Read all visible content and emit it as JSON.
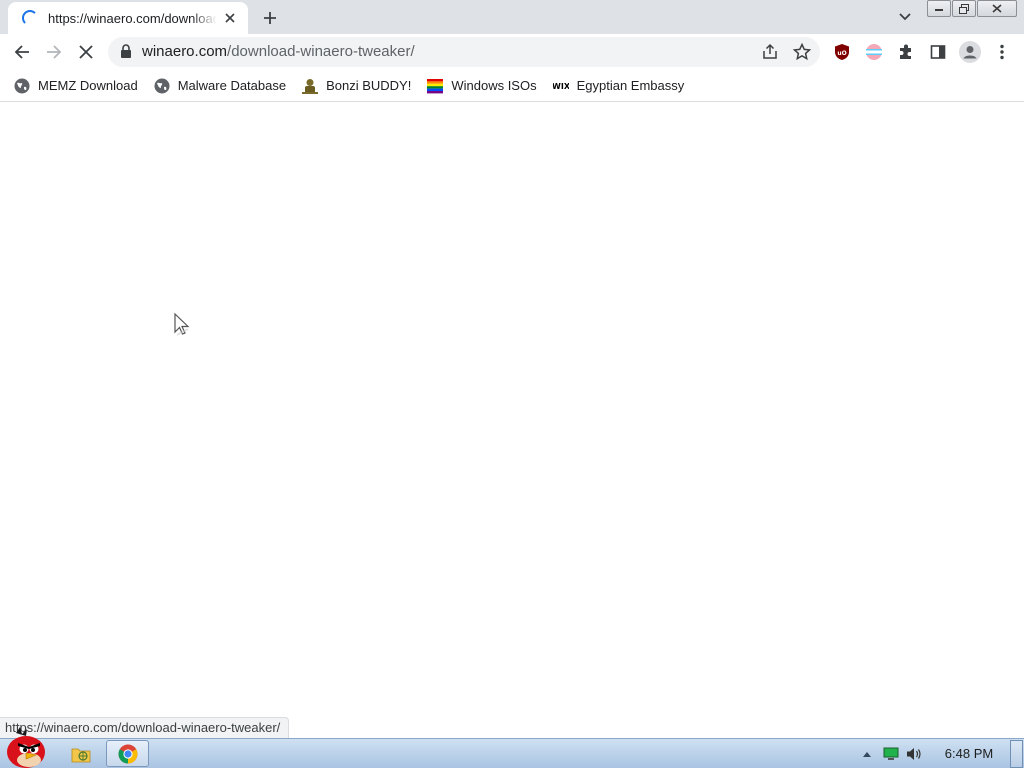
{
  "browser": {
    "tab": {
      "title": "https://winaero.com/download-winaero-tweaker/"
    },
    "address_bar": {
      "domain": "winaero.com",
      "path": "/download-winaero-tweaker/"
    },
    "bookmarks": [
      {
        "label": "MEMZ Download",
        "icon": "globe-icon"
      },
      {
        "label": "Malware Database",
        "icon": "globe-icon"
      },
      {
        "label": "Bonzi BUDDY!",
        "icon": "bonzi-icon"
      },
      {
        "label": "Windows ISOs",
        "icon": "rainbow-flag-icon"
      },
      {
        "label": "Egyptian Embassy",
        "icon": "wix-icon"
      }
    ],
    "status_url": "https://winaero.com/download-winaero-tweaker/"
  },
  "taskbar": {
    "clock": "6:48 PM"
  },
  "colors": {
    "accent": "#1a73e8",
    "ublock": "#800000",
    "taskbar_top": "#cfe0f2",
    "taskbar_bottom": "#a9c4e2"
  }
}
